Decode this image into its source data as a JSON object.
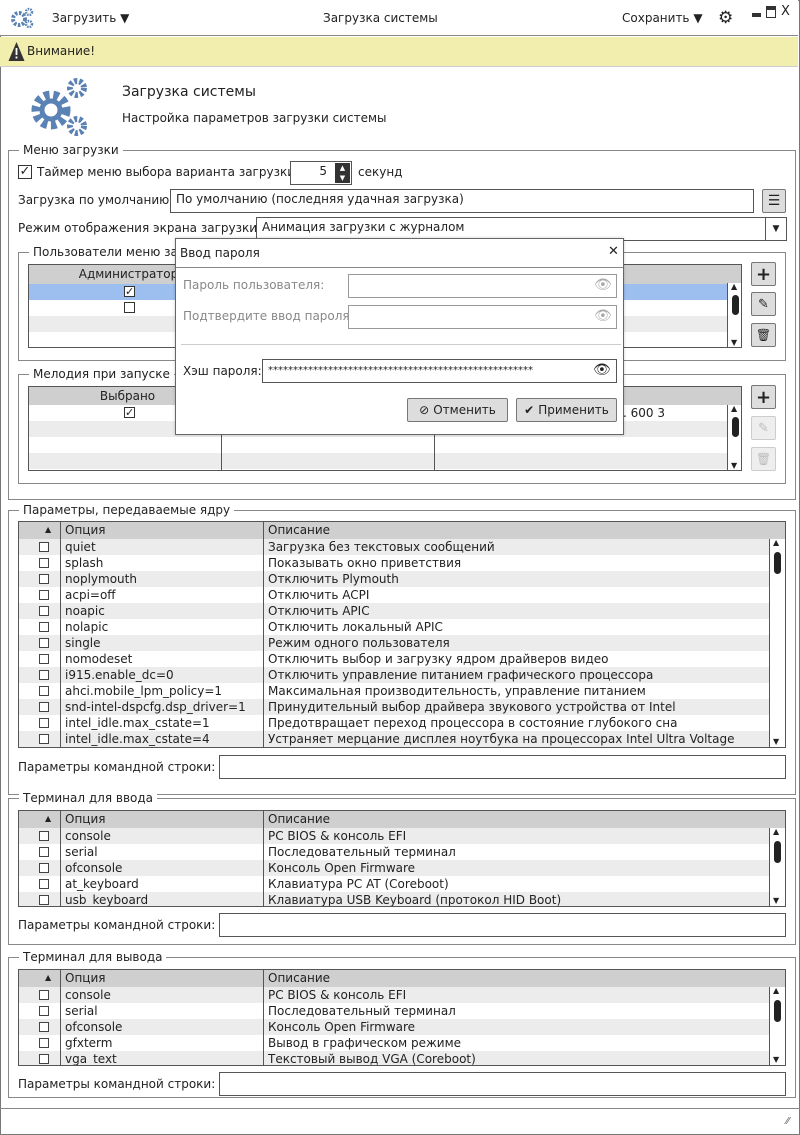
{
  "titlebar": {
    "load_menu": "Загрузить",
    "title": "Загрузка системы",
    "save_menu": "Сохранить",
    "close": "X"
  },
  "notice": {
    "text": "Внимание!"
  },
  "header": {
    "title": "Загрузка системы",
    "subtitle": "Настройка параметров загрузки системы"
  },
  "colors": {
    "accent": "#5a82b4",
    "notice_bg": "#f2eeae",
    "selected_row": "#9dbff0",
    "header_bg": "#cfcfcf"
  },
  "boot_menu": {
    "legend": "Меню загрузки",
    "timer_label": "Таймер меню выбора варианта загрузки:",
    "timer_checked": true,
    "timer_value": "5",
    "timer_unit": "секунд",
    "default_label": "Загрузка по умолчанию:",
    "default_value": "По умолчанию (последняя удачная загрузка)",
    "display_label": "Режим отображения экрана загрузки:",
    "display_value": "Анимация загрузки с журналом"
  },
  "users": {
    "legend": "Пользователи меню загр",
    "header": "Администратор",
    "rows": [
      {
        "admin": true
      },
      {
        "admin": false
      },
      {},
      {}
    ]
  },
  "melody": {
    "legend": "Мелодия при запуске",
    "header": "Выбрано",
    "rows": [
      {
        "selected": true,
        "value": ". 600 3"
      },
      {},
      {},
      {}
    ]
  },
  "dialog": {
    "title": "Ввод пароля",
    "password_label": "Пароль пользователя:",
    "confirm_label": "Подтвердите ввод пароля:",
    "hash_label": "Хэш пароля:",
    "hash_value": "*****************************************************",
    "cancel": "Отменить",
    "apply": "Применить"
  },
  "kernel": {
    "legend": "Параметры, передаваемые ядру",
    "col_option": "Опция",
    "col_desc": "Описание",
    "rows": [
      {
        "option": "quiet",
        "desc": "Загрузка без текстовых сообщений"
      },
      {
        "option": "splash",
        "desc": "Показывать окно приветствия"
      },
      {
        "option": "noplymouth",
        "desc": "Отключить Plymouth"
      },
      {
        "option": "acpi=off",
        "desc": "Отключить ACPI"
      },
      {
        "option": "noapic",
        "desc": "Отключить APIC"
      },
      {
        "option": "nolapic",
        "desc": "Отключить локальный APIC"
      },
      {
        "option": "single",
        "desc": "Режим одного пользователя"
      },
      {
        "option": "nomodeset",
        "desc": "Отключить выбор и загрузку ядром драйверов видео"
      },
      {
        "option": "i915.enable_dc=0",
        "desc": "Отключить управление питанием графического процессора"
      },
      {
        "option": "ahci.mobile_lpm_policy=1",
        "desc": "Максимальная производительность, управление питанием"
      },
      {
        "option": "snd-intel-dspcfg.dsp_driver=1",
        "desc": "Принудительный выбор драйвера звукового устройства от Intel"
      },
      {
        "option": "intel_idle.max_cstate=1",
        "desc": "Предотвращает переход процессора в состояние глубокого сна"
      },
      {
        "option": "intel_idle.max_cstate=4",
        "desc": "Устраняет мерцание дисплея ноутбука на процессорах Intel Ultra Voltage"
      }
    ],
    "cmdline_label": "Параметры командной строки:",
    "cmdline_value": ""
  },
  "term_in": {
    "legend": "Терминал для ввода",
    "col_option": "Опция",
    "col_desc": "Описание",
    "rows": [
      {
        "option": "console",
        "desc": "PC BIOS & консоль EFI"
      },
      {
        "option": "serial",
        "desc": "Последовательный терминал"
      },
      {
        "option": "ofconsole",
        "desc": "Консоль Open Firmware"
      },
      {
        "option": "at_keyboard",
        "desc": "Клавиатура PC AT (Coreboot)"
      },
      {
        "option": "usb_keyboard",
        "desc": "Клавиатура USB Keyboard (протокол HID Boot)"
      }
    ],
    "cmdline_label": "Параметры командной строки:",
    "cmdline_value": ""
  },
  "term_out": {
    "legend": "Терминал для вывода",
    "col_option": "Опция",
    "col_desc": "Описание",
    "rows": [
      {
        "option": "console",
        "desc": "PC BIOS & консоль EFI"
      },
      {
        "option": "serial",
        "desc": "Последовательный терминал"
      },
      {
        "option": "ofconsole",
        "desc": "Консоль Open Firmware"
      },
      {
        "option": "gfxterm",
        "desc": "Вывод в графическом режиме"
      },
      {
        "option": "vga_text",
        "desc": "Текстовый вывод VGA (Coreboot)"
      }
    ],
    "cmdline_label": "Параметры командной строки:",
    "cmdline_value": ""
  }
}
